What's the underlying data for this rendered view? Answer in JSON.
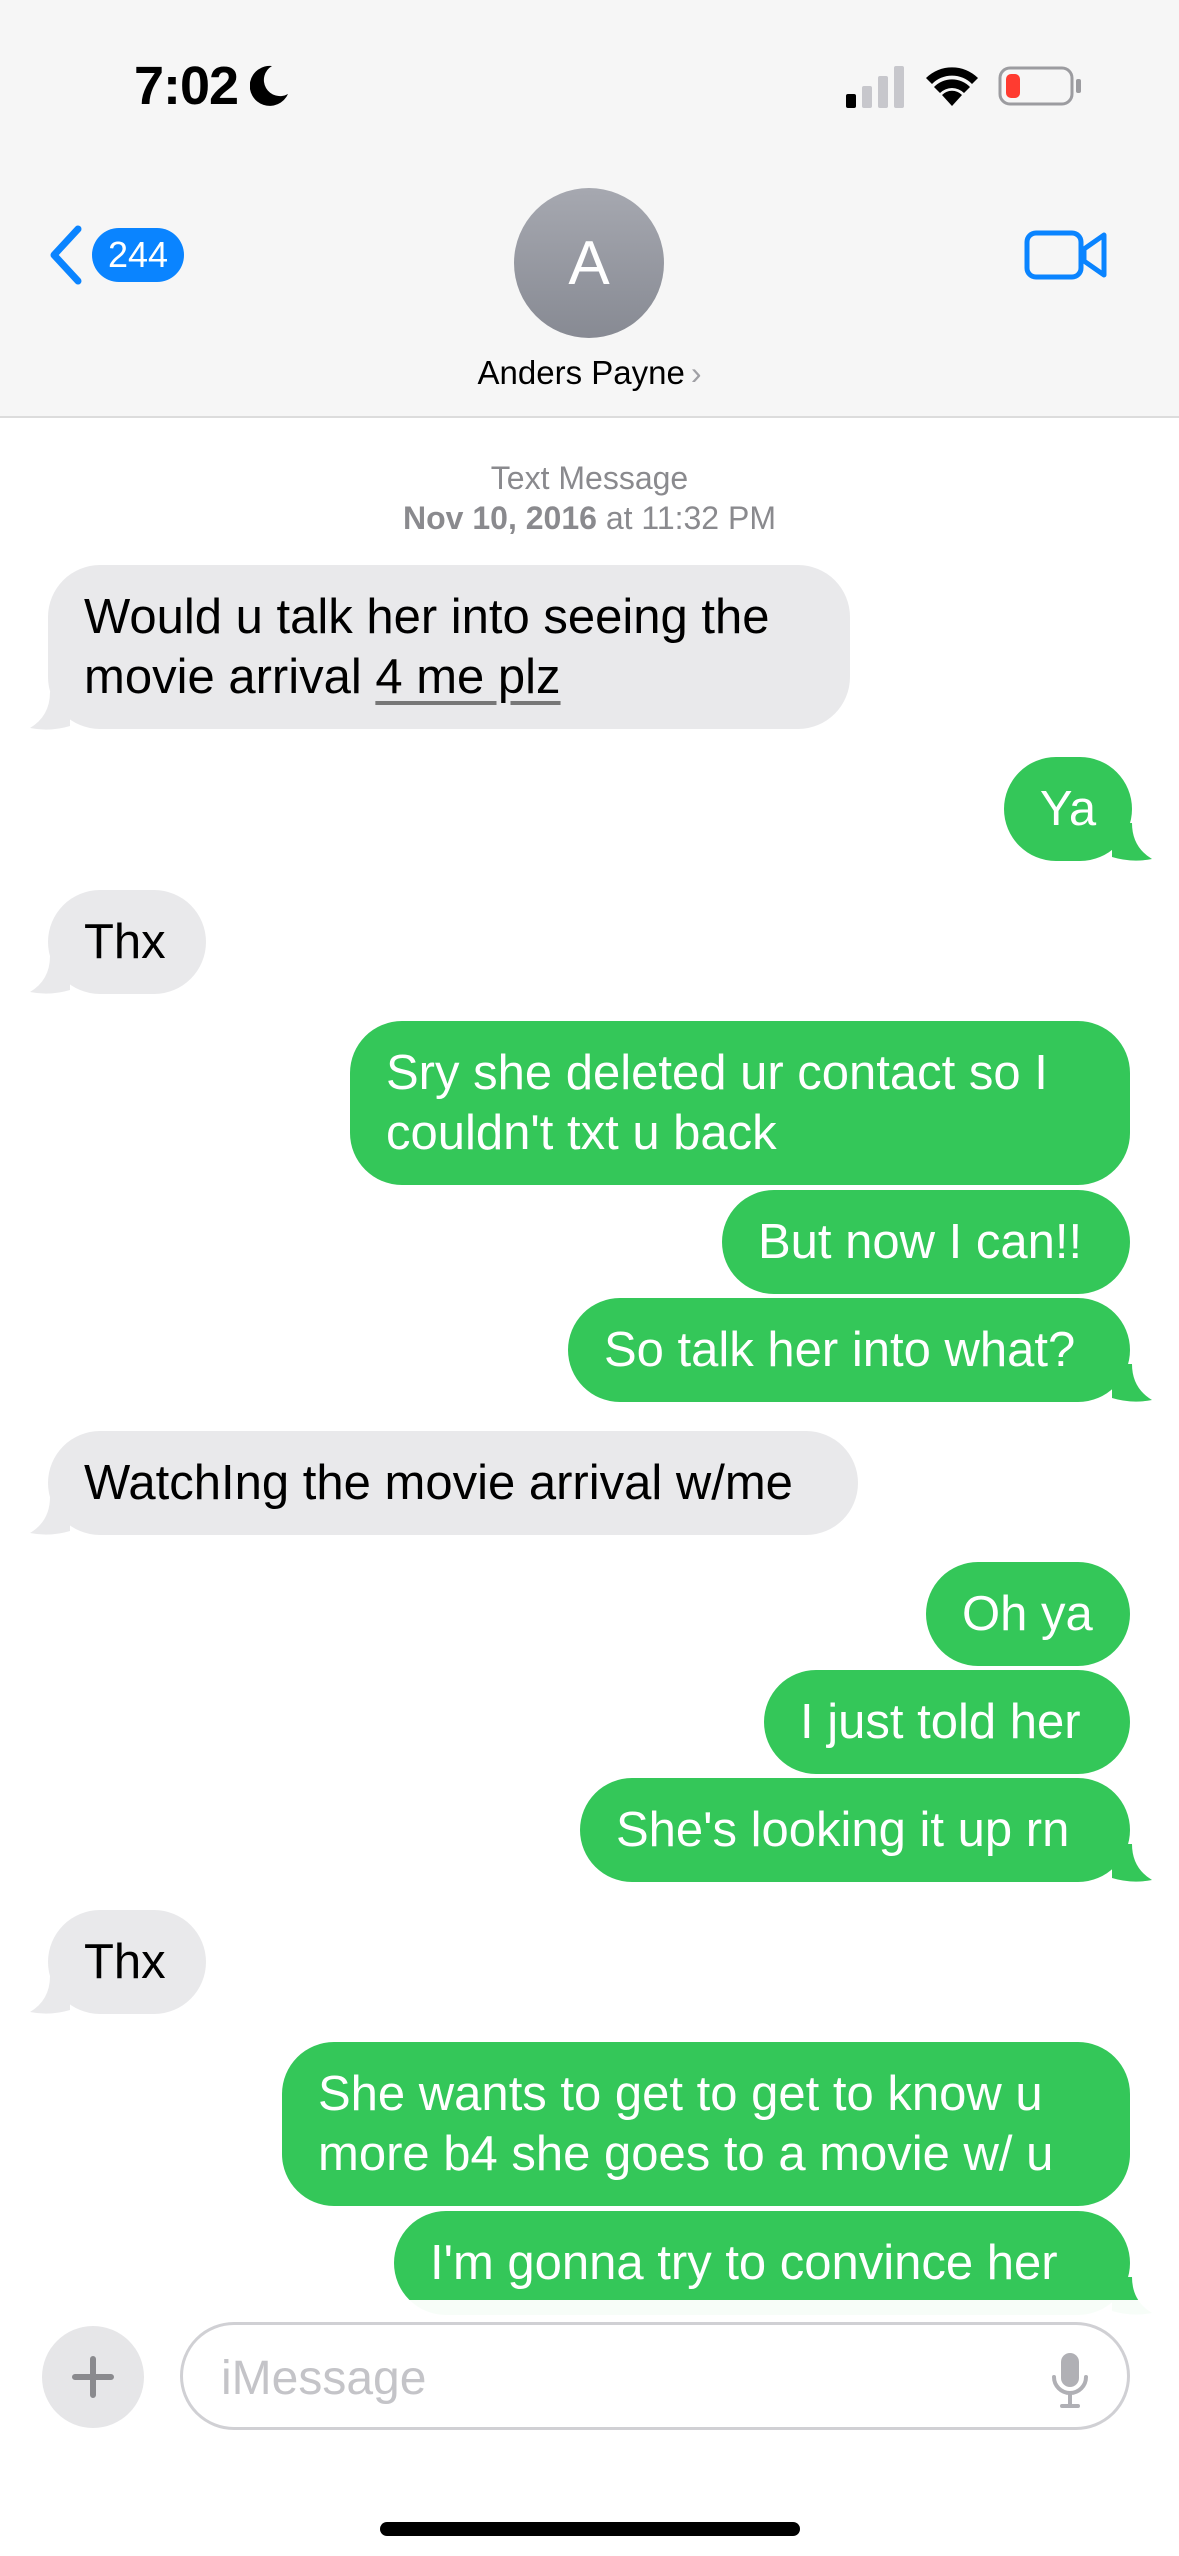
{
  "status_bar": {
    "time": "7:02"
  },
  "header": {
    "back_count": "244",
    "avatar_initial": "A",
    "contact_name": "Anders Payne",
    "chevron": "›"
  },
  "timestamp": {
    "label": "Text Message",
    "date": "Nov 10, 2016",
    "at": "at",
    "time": "11:32 PM"
  },
  "messages": [
    {
      "dir": "in",
      "line1": "Would u talk her into seeing the",
      "line2a": "movie arrival ",
      "line2b": "4 me plz"
    },
    {
      "dir": "out",
      "text": "Ya"
    },
    {
      "dir": "in",
      "text": "Thx"
    },
    {
      "dir": "out",
      "line1": "Sry she deleted ur contact so I",
      "line2": "couldn't txt u back"
    },
    {
      "dir": "out",
      "text": "But now I can!!"
    },
    {
      "dir": "out",
      "text": "So talk her into what?"
    },
    {
      "dir": "in",
      "text": "WatchIng the movie arrival w/me"
    },
    {
      "dir": "out",
      "text": "Oh ya"
    },
    {
      "dir": "out",
      "text": "I just told her"
    },
    {
      "dir": "out",
      "text": "She's looking it up rn"
    },
    {
      "dir": "in",
      "text": "Thx"
    },
    {
      "dir": "out",
      "line1": "She wants to get to get to know u",
      "line2": "more b4 she goes to a movie w/ u"
    },
    {
      "dir": "out",
      "text": "I'm gonna try to convince her"
    }
  ],
  "composer": {
    "placeholder": "iMessage"
  },
  "colors": {
    "outgoing": "#34c759",
    "incoming": "#e9e9eb",
    "accent": "#0a84ff"
  },
  "icons": {
    "moon": "moon-icon",
    "signal": "cellular-signal-icon",
    "wifi": "wifi-icon",
    "battery": "battery-low-icon",
    "back": "chevron-left-icon",
    "video": "facetime-video-icon",
    "plus": "plus-icon",
    "mic": "microphone-icon"
  }
}
